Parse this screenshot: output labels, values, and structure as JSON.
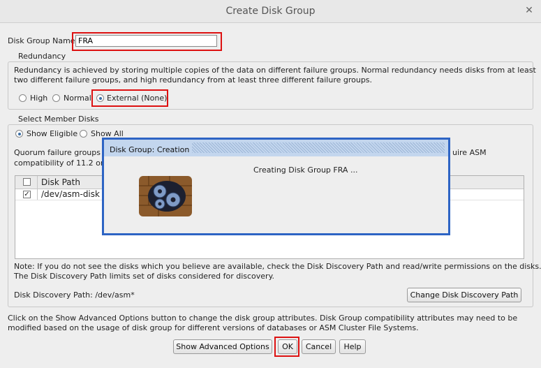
{
  "window": {
    "title": "Create Disk Group"
  },
  "disk_group_name": {
    "label": "Disk Group Name",
    "value": "FRA"
  },
  "redundancy": {
    "legend": "Redundancy",
    "description_line1": "Redundancy is achieved by storing multiple copies of the data on different failure groups. Normal redundancy needs disks from at least",
    "description_line2": "two different failure groups, and high redundancy from at least three different failure groups.",
    "options": [
      "High",
      "Normal",
      "External (None)"
    ],
    "selected": "External (None)"
  },
  "member_disks": {
    "legend": "Select Member Disks",
    "filters": [
      "Show Eligible",
      "Show All"
    ],
    "selected_filter": "Show Eligible",
    "quorum_text_start": "Quorum failure groups",
    "quorum_text_end": "uire ASM",
    "compat_text": "compatibility of 11.2 or",
    "table": {
      "header": "Disk Path",
      "rows": [
        {
          "checked": true,
          "path": "/dev/asm-disk"
        }
      ]
    },
    "note_line1": "Note: If you do not see the disks which you believe are available, check the Disk Discovery Path and read/write permissions on the disks.",
    "note_line2": "The Disk Discovery Path limits set of disks considered for discovery.",
    "discovery_path_label": "Disk Discovery Path: /dev/asm*",
    "change_discovery_button": "Change Disk Discovery Path"
  },
  "advanced_note_line1": "Click on the Show Advanced Options button to change the disk group attributes. Disk Group compatibility attributes may need to be",
  "advanced_note_line2": "modified based on the usage of disk group for different versions of databases or ASM Cluster File Systems.",
  "buttons": {
    "advanced": "Show Advanced Options",
    "ok": "OK",
    "cancel": "Cancel",
    "help": "Help"
  },
  "progress_dialog": {
    "title": "Disk Group: Creation",
    "message": "Creating Disk Group FRA ..."
  },
  "colors": {
    "highlight": "#dd1111",
    "dialog_border": "#2d64c4"
  }
}
